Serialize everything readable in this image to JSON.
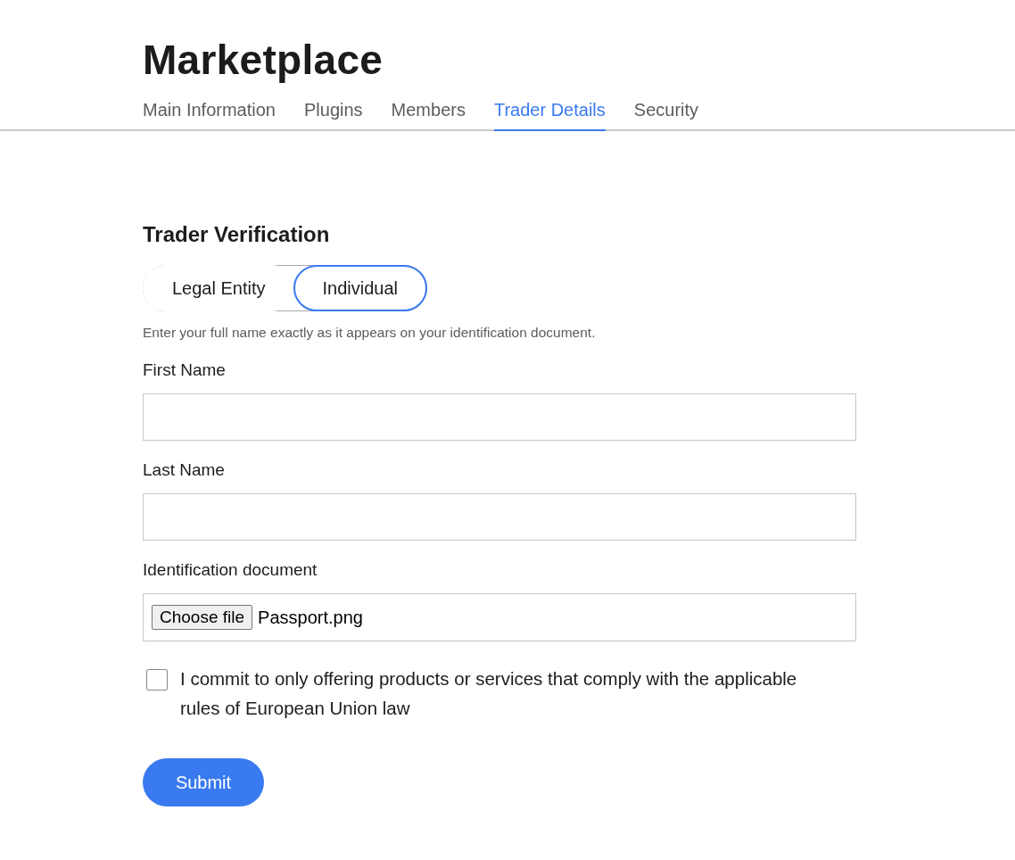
{
  "page": {
    "title": "Marketplace"
  },
  "tabs": [
    {
      "label": "Main Information",
      "selected": false
    },
    {
      "label": "Plugins",
      "selected": false
    },
    {
      "label": "Members",
      "selected": false
    },
    {
      "label": "Trader Details",
      "selected": true
    },
    {
      "label": "Security",
      "selected": false
    }
  ],
  "form": {
    "heading": "Trader Verification",
    "entity_types": [
      {
        "label": "Legal Entity",
        "selected": false
      },
      {
        "label": "Individual",
        "selected": true
      }
    ],
    "hint": "Enter your full name exactly as it appears on your identification document.",
    "fields": [
      {
        "kind": "text",
        "label": "First Name"
      },
      {
        "kind": "text",
        "label": "Last Name"
      },
      {
        "kind": "file",
        "label": "Identification document",
        "button": "Choose file",
        "value": "Passport.png"
      }
    ],
    "agreement": {
      "label": "I commit to only offering products or services that comply with the applicable rules of European Union law",
      "checked": false
    },
    "submit": "Submit"
  }
}
